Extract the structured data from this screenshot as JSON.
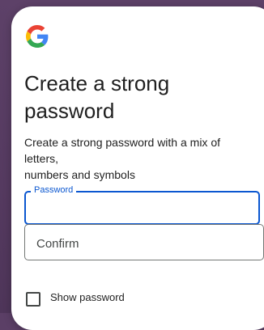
{
  "card": {
    "logo": "google-g-logo",
    "title_lines": [
      "Create a strong",
      "password"
    ],
    "description_lines": [
      "Create a strong password with a mix of letters,",
      "numbers and symbols"
    ]
  },
  "password_field": {
    "label": "Password",
    "value": "",
    "focused": true
  },
  "confirm_field": {
    "placeholder": "Confirm",
    "value": ""
  },
  "show_password": {
    "label": "Show password",
    "checked": false
  },
  "colors": {
    "accent": "#0b57d0",
    "background": "#5b3f66",
    "text": "#1f1f1f",
    "border": "#747775"
  }
}
